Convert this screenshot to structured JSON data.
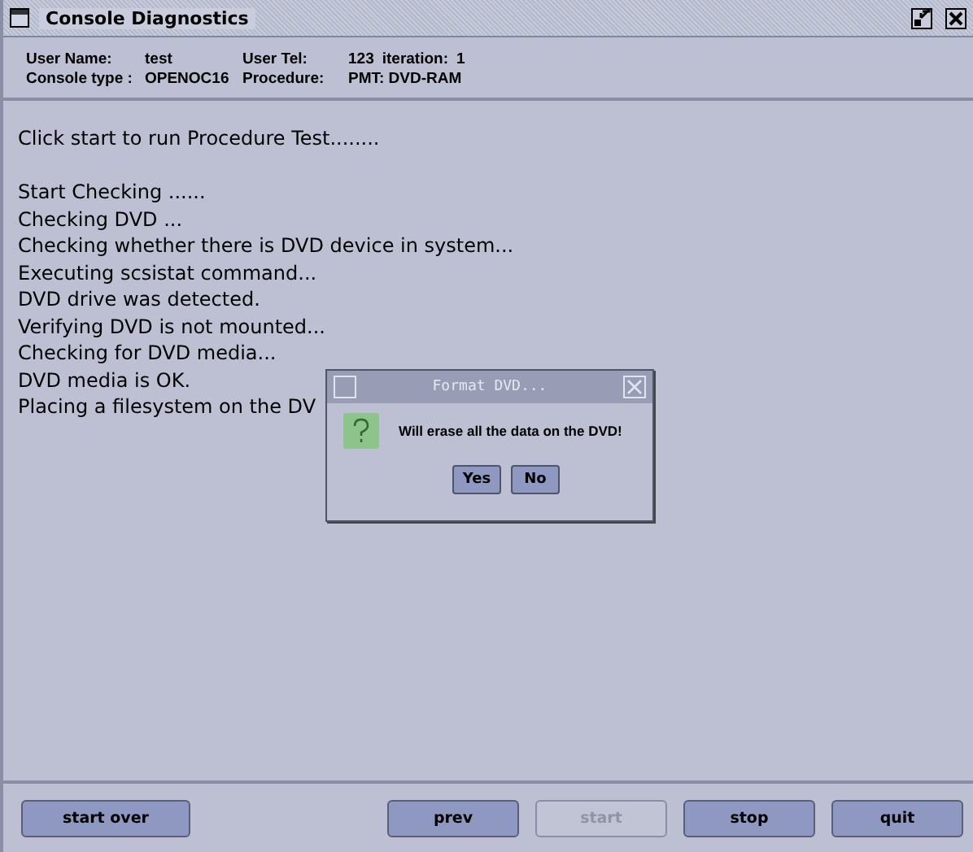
{
  "window": {
    "title": "Console Diagnostics"
  },
  "info": [
    {
      "label": "User Name:",
      "value": "test"
    },
    {
      "label": "User Tel:",
      "value": "123"
    },
    {
      "label": "iteration:",
      "value": "1"
    },
    {
      "label": "Console type :",
      "value": "OPENOC16"
    },
    {
      "label": "Procedure:",
      "value": "PMT: DVD-RAM"
    }
  ],
  "intro": "Click start to run Procedure Test........",
  "log": [
    "Start Checking ......",
    "Checking DVD ...",
    "Checking whether there is DVD device in system...",
    "Executing scsistat command...",
    "DVD drive was detected.",
    "Verifying DVD is not mounted...",
    "Checking for DVD media...",
    "DVD media is OK.",
    "Placing a filesystem on the DV"
  ],
  "dialog": {
    "title": "Format DVD...",
    "message": "Will erase all the data on the DVD!",
    "buttons": [
      "Yes",
      "No"
    ]
  },
  "buttons": [
    {
      "label": "start over",
      "disabled": false
    },
    {
      "label": "prev",
      "disabled": false
    },
    {
      "label": "start",
      "disabled": true
    },
    {
      "label": "stop",
      "disabled": false
    },
    {
      "label": "quit",
      "disabled": false
    }
  ]
}
